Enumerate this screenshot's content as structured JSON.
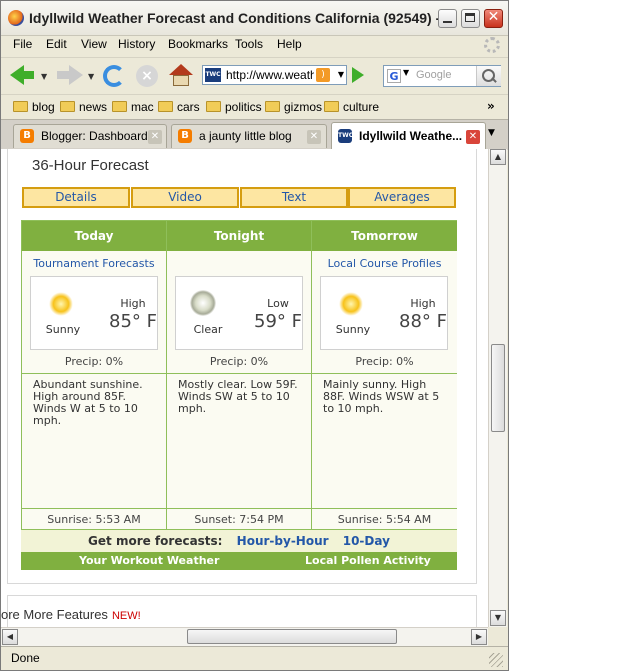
{
  "window": {
    "title": "Idyllwild Weather Forecast and Conditions California (92549) -...",
    "close_glyph": "✕"
  },
  "menu": [
    "File",
    "Edit",
    "View",
    "History",
    "Bookmarks",
    "Tools",
    "Help"
  ],
  "nav": {
    "url": "http://www.weather.com",
    "site_icon_text": "TWC",
    "search_placeholder": "Google",
    "search_engine_letter": "G"
  },
  "bookmarks": [
    "blog",
    "news",
    "mac",
    "cars",
    "politics",
    "gizmos",
    "culture"
  ],
  "tabs": [
    {
      "label": "Blogger: Dashboard",
      "fav": "B"
    },
    {
      "label": "a jaunty little blog",
      "fav": "B"
    },
    {
      "label": "Idyllwild Weathe...",
      "fav": "TWC"
    }
  ],
  "forecast": {
    "section_title": "36-Hour Forecast",
    "subtabs": [
      "Details",
      "Video",
      "Text",
      "Averages"
    ],
    "columns": [
      {
        "head": "Today",
        "link": "Tournament Forecasts",
        "icon": "sun-icon",
        "condition": "Sunny",
        "hilo_label": "High",
        "temp": "85° F",
        "precip": "Precip: 0%",
        "description": "Abundant sunshine. High around 85F. Winds W at 5 to 10 mph.",
        "sun_event": "Sunrise: 5:53 AM"
      },
      {
        "head": "Tonight",
        "link": "",
        "icon": "moon-icon",
        "condition": "Clear",
        "hilo_label": "Low",
        "temp": "59° F",
        "precip": "Precip: 0%",
        "description": "Mostly clear. Low 59F. Winds SW at 5 to 10 mph.",
        "sun_event": "Sunset: 7:54 PM"
      },
      {
        "head": "Tomorrow",
        "link": "Local Course Profiles",
        "icon": "sun-icon",
        "condition": "Sunny",
        "hilo_label": "High",
        "temp": "88° F",
        "precip": "Precip: 0%",
        "description": "Mainly sunny. High 88F. Winds WSW at 5 to 10 mph.",
        "sun_event": "Sunrise: 5:54 AM"
      }
    ],
    "more_label": "Get more forecasts:",
    "more_links": [
      "Hour-by-Hour",
      "10-Day"
    ],
    "green_links": [
      "Your Workout Weather",
      "Local Pollen Activity"
    ],
    "more_features": "ore More Features",
    "new_badge": "NEW!"
  },
  "status": "Done"
}
